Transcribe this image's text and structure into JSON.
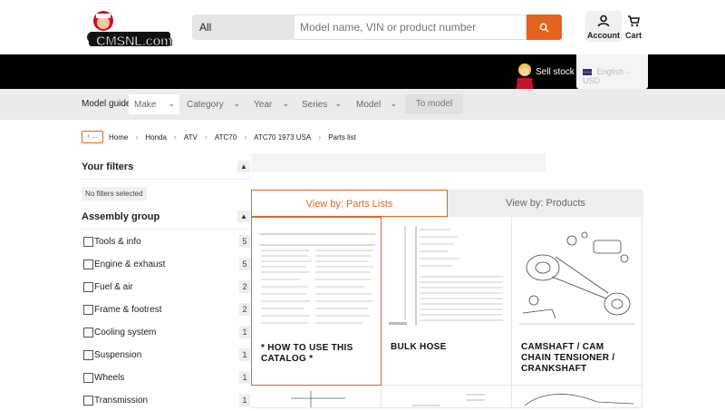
{
  "header": {
    "logo_text": "CMSNL.com",
    "search_category": "All",
    "search_placeholder": "Model name, VIN or product number",
    "account_label": "Account",
    "cart_label": "Cart",
    "accent_color": "#e8621f"
  },
  "topbar": {
    "sell_stock": "Sell stock",
    "language": "English - USD"
  },
  "model_guide": {
    "label": "Model guide",
    "make": "Make",
    "category": "Category",
    "year": "Year",
    "series": "Series",
    "model": "Model",
    "to_model": "To model"
  },
  "breadcrumb": {
    "back": "‹ ...",
    "items": [
      "Home",
      "Honda",
      "ATV",
      "ATC70",
      "ATC70 1973 USA",
      "Parts list"
    ]
  },
  "sidebar": {
    "filters_title": "Your filters",
    "no_filters": "No filters selected",
    "assembly_title": "Assembly group",
    "groups": [
      {
        "label": "Tools & info",
        "count": "5"
      },
      {
        "label": "Engine & exhaust",
        "count": "5"
      },
      {
        "label": "Fuel & air",
        "count": "2"
      },
      {
        "label": "Frame & footrest",
        "count": "2"
      },
      {
        "label": "Cooling system",
        "count": "1"
      },
      {
        "label": "Suspension",
        "count": "1"
      },
      {
        "label": "Wheels",
        "count": "1"
      },
      {
        "label": "Transmission",
        "count": "1"
      }
    ]
  },
  "view_tabs": {
    "parts_lists": "View by: Parts Lists",
    "products": "View by: Products"
  },
  "cards": [
    {
      "title": "* HOW TO USE THIS CATALOG *"
    },
    {
      "title": "BULK HOSE"
    },
    {
      "title": "CAMSHAFT / CAM CHAIN TENSIONER / CRANKSHAFT"
    }
  ]
}
